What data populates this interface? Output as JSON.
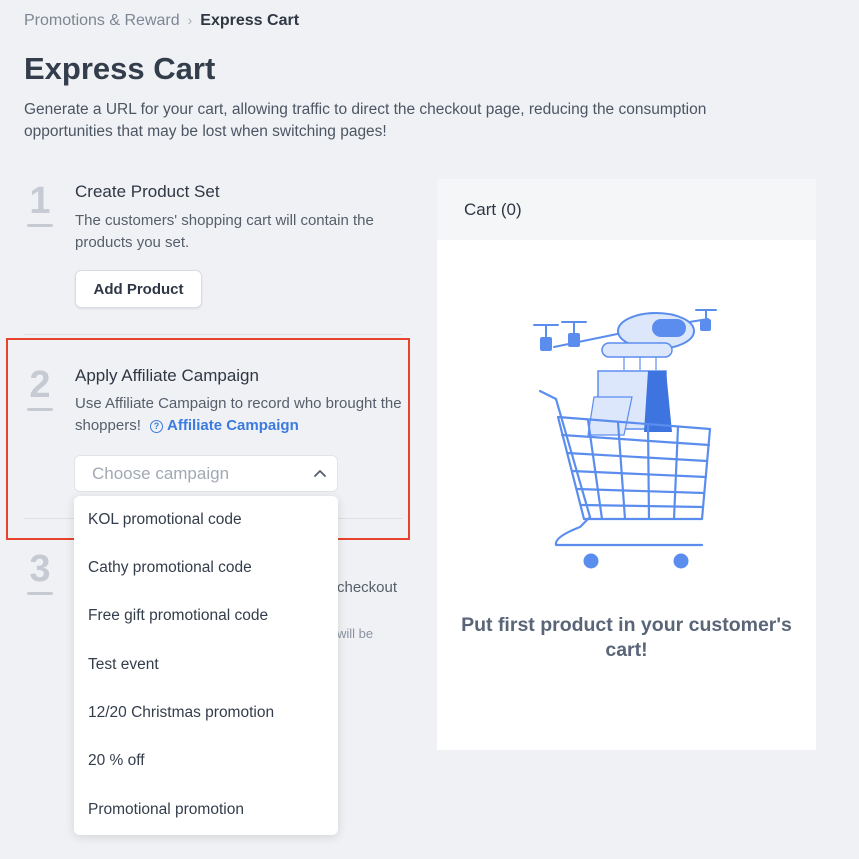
{
  "breadcrumb": {
    "parent": "Promotions & Reward",
    "separator": "›",
    "current": "Express Cart"
  },
  "page": {
    "title": "Express Cart",
    "description": "Generate a URL for your cart, allowing traffic to direct the checkout page, reducing the consumption opportunities that may be lost when switching pages!"
  },
  "steps": [
    {
      "number": "1",
      "title": "Create Product Set",
      "description": "The customers' shopping cart will contain the products you set.",
      "button": "Add Product"
    },
    {
      "number": "2",
      "title": "Apply Affiliate Campaign",
      "description": "Use Affiliate Campaign to record who brought the shoppers!",
      "help_icon": "?",
      "link": "Affiliate Campaign"
    },
    {
      "number": "3",
      "partial_line1": "checkout",
      "partial_line2": "will be"
    }
  ],
  "campaign_select": {
    "placeholder": "Choose campaign",
    "options": [
      "KOL promotional code",
      "Cathy promotional code",
      "Free gift promotional code",
      "Test event",
      "12/20 Christmas promotion",
      "20 % off",
      "Promotional promotion"
    ]
  },
  "cart": {
    "header": "Cart (0)",
    "empty_message": "Put first product in your customer's cart!"
  },
  "colors": {
    "accent": "#3b7be0",
    "highlight": "#e8412c",
    "illustration": "#5b8def"
  },
  "icons": {
    "chevron": "chevron-up-icon",
    "help": "question-circle-icon",
    "illustration": "drone-shopping-cart-icon"
  }
}
